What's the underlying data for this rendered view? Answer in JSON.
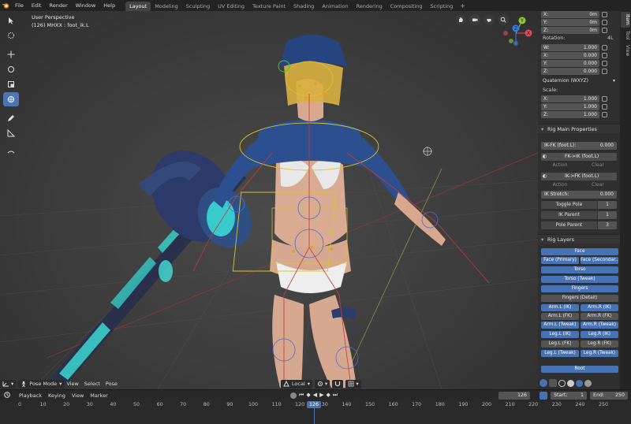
{
  "menu": {
    "items": [
      "File",
      "Edit",
      "Render",
      "Window",
      "Help"
    ],
    "workspaces": [
      "Layout",
      "Modeling",
      "Sculpting",
      "UV Editing",
      "Texture Paint",
      "Shading",
      "Animation",
      "Rendering",
      "Compositing",
      "Scripting"
    ],
    "active_workspace": "Layout",
    "add_tab": "+"
  },
  "viewport": {
    "perspective": "User Perspective",
    "object_info": "(126) MHXX : foot_ik.L",
    "gizmo_axes": {
      "y": "Y",
      "x": "X",
      "z": "Z"
    },
    "header": {
      "mode": "Pose Mode",
      "menus": [
        "View",
        "Select",
        "Pose"
      ],
      "orientation": "Local"
    }
  },
  "npanel": {
    "tabs": [
      "Item",
      "Tool",
      "View"
    ],
    "location": {
      "x": "0m",
      "y": "0m",
      "z": "0m"
    },
    "rotation_label": "Rotation:",
    "rotation_order": "4L",
    "rotation": {
      "w": "1.000",
      "x": "0.000",
      "y": "0.000",
      "z": "0.000"
    },
    "rotation_mode": "Quaternion (WXYZ)",
    "scale_label": "Scale:",
    "scale": {
      "x": "1.000",
      "y": "1.000",
      "z": "1.000"
    },
    "axis_labels": {
      "w": "W:",
      "x": "X:",
      "y": "Y:",
      "z": "Z:"
    },
    "rig_main": {
      "title": "Rig Main Properties",
      "ik_fk_label": "IK-FK (foot.L):",
      "ik_fk_value": "0.000",
      "fk_to_ik": "FK->IK (foot.L)",
      "ik_to_fk": "IK->FK (foot.L)",
      "action": "Action",
      "clear": "Clear",
      "ik_stretch_label": "IK Stretch:",
      "ik_stretch_value": "0.000",
      "toggle_pole_label": "Toggle Pole",
      "toggle_pole_value": "1",
      "ik_parent_label": "IK Parent",
      "ik_parent_value": "1",
      "pole_parent_label": "Pole Parent",
      "pole_parent_value": "3"
    },
    "rig_layers": {
      "title": "Rig Layers",
      "face": "Face",
      "face_primary": "Face (Primary)",
      "face_secondary": "Face (Secondar...",
      "torso": "Torso",
      "torso_tweak": "Torso (Tweak)",
      "fingers": "Fingers",
      "fingers_detail": "Fingers (Detail)",
      "arm_l_ik": "Arm.L (IK)",
      "arm_r_ik": "Arm.R (IK)",
      "arm_l_fk": "Arm.L (FK)",
      "arm_r_fk": "Arm.R (FK)",
      "arm_l_tweak": "Arm.L (Tweak)",
      "arm_r_tweak": "Arm.R (Tweak)",
      "leg_l_ik": "Leg.L (IK)",
      "leg_r_ik": "Leg.R (IK)",
      "leg_l_fk": "Leg.L (FK)",
      "leg_r_fk": "Leg.R (FK)",
      "leg_l_tweak": "Leg.L (Tweak)",
      "leg_r_tweak": "Leg.R (Tweak)",
      "root": "Root"
    }
  },
  "timeline": {
    "menus": [
      "Playback",
      "Keying",
      "View",
      "Marker"
    ],
    "current_frame": "126",
    "start_label": "Start:",
    "start_value": "1",
    "end_label": "End:",
    "end_value": "250",
    "ticks": [
      "0",
      "10",
      "20",
      "30",
      "40",
      "50",
      "60",
      "70",
      "80",
      "90",
      "100",
      "110",
      "120",
      "126",
      "130",
      "140",
      "150",
      "160",
      "170",
      "180",
      "190",
      "200",
      "210",
      "220",
      "230",
      "240",
      "250"
    ],
    "playhead_frame": 126
  },
  "colors": {
    "accent": "#4772b3",
    "panel_bg": "#2f2f2f",
    "viewport_bg": "#3c3c3c"
  }
}
